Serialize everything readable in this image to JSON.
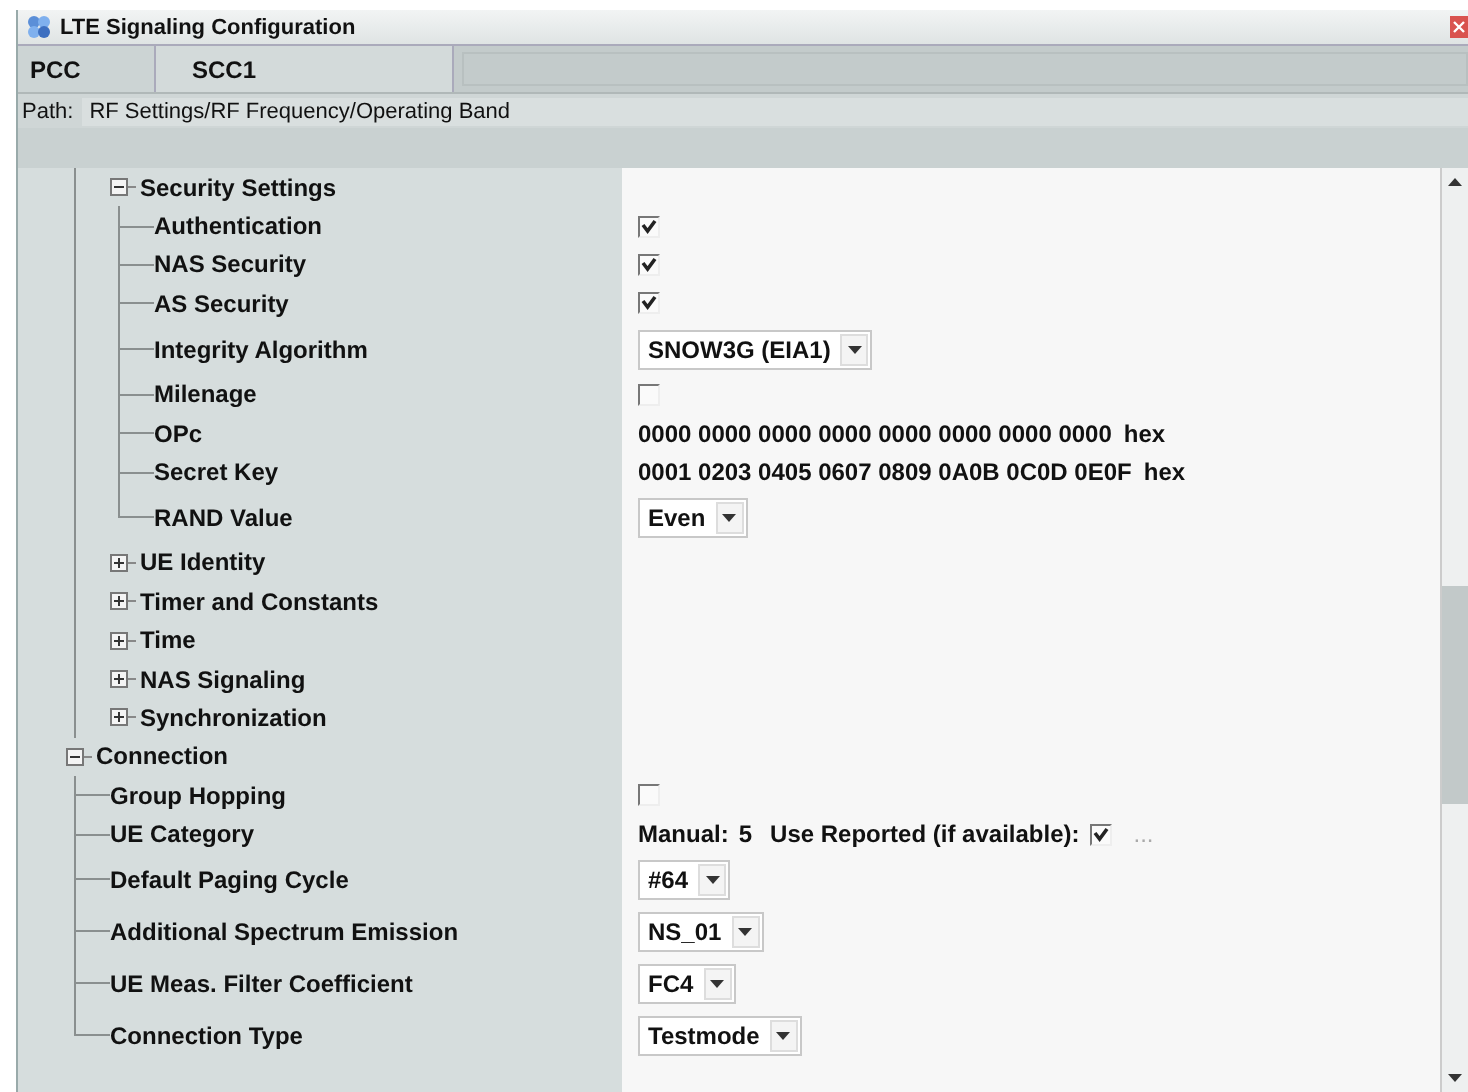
{
  "window": {
    "title": "LTE Signaling Configuration"
  },
  "tabs": [
    {
      "label": "PCC",
      "selected": false
    },
    {
      "label": "SCC1",
      "selected": true
    }
  ],
  "path": {
    "label": "Path:",
    "value": "RF Settings/RF Frequency/Operating Band"
  },
  "tree": {
    "continued_children": [
      {
        "label": "Security Settings",
        "expanded": true,
        "children": [
          {
            "label": "Authentication",
            "value": {
              "kind": "checkbox",
              "checked": true
            }
          },
          {
            "label": "NAS Security",
            "value": {
              "kind": "checkbox",
              "checked": true
            }
          },
          {
            "label": "AS Security",
            "value": {
              "kind": "checkbox",
              "checked": true
            }
          },
          {
            "label": "Integrity Algorithm",
            "value": {
              "kind": "dropdown",
              "value": "SNOW3G (EIA1)"
            }
          },
          {
            "label": "Milenage",
            "value": {
              "kind": "checkbox",
              "checked": false
            }
          },
          {
            "label": "OPc",
            "value": {
              "kind": "text",
              "value": "0000 0000 0000 0000 0000 0000 0000 0000",
              "unit": "hex"
            }
          },
          {
            "label": "Secret Key",
            "value": {
              "kind": "text",
              "value": "0001 0203 0405 0607 0809 0A0B 0C0D 0E0F",
              "unit": "hex"
            }
          },
          {
            "label": "RAND Value",
            "value": {
              "kind": "dropdown",
              "value": "Even"
            }
          }
        ]
      },
      {
        "label": "UE Identity",
        "expanded": false
      },
      {
        "label": "Timer and Constants",
        "expanded": false
      },
      {
        "label": "Time",
        "expanded": false
      },
      {
        "label": "NAS Signaling",
        "expanded": false
      },
      {
        "label": "Synchronization",
        "expanded": false
      }
    ],
    "nodes": [
      {
        "label": "Connection",
        "expanded": true,
        "children": [
          {
            "label": "Group Hopping",
            "value": {
              "kind": "checkbox",
              "checked": false
            }
          },
          {
            "label": "UE Category",
            "value": {
              "kind": "ue_category",
              "manual_label": "Manual:",
              "manual_value": "5",
              "reported_label": "Use Reported (if available):",
              "reported_checked": true,
              "more_button": "..."
            }
          },
          {
            "label": "Default Paging Cycle",
            "value": {
              "kind": "dropdown",
              "value": "#64"
            }
          },
          {
            "label": "Additional Spectrum Emission",
            "value": {
              "kind": "dropdown",
              "value": "NS_01"
            }
          },
          {
            "label": "UE Meas. Filter Coefficient",
            "value": {
              "kind": "dropdown",
              "value": "FC4"
            }
          },
          {
            "label": "Connection Type",
            "value": {
              "kind": "dropdown",
              "value": "Testmode"
            }
          }
        ]
      }
    ]
  }
}
